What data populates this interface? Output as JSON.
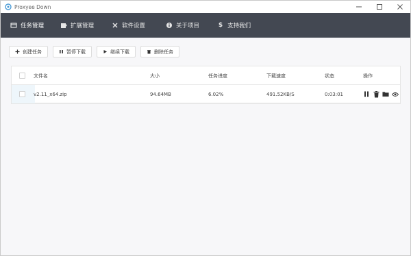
{
  "window": {
    "title": "Proxyee Down",
    "controls": [
      "minimize-icon",
      "maximize-icon",
      "close-icon"
    ]
  },
  "nav": {
    "items": [
      {
        "label": "任务管理",
        "icon": "download-list-icon",
        "active": true
      },
      {
        "label": "扩展管理",
        "icon": "puzzle-icon",
        "active": false
      },
      {
        "label": "软件设置",
        "icon": "tools-icon",
        "active": false
      },
      {
        "label": "关于项目",
        "icon": "info-icon",
        "active": false
      },
      {
        "label": "支持我们",
        "icon": "dollar-icon",
        "active": false
      }
    ]
  },
  "toolbar": {
    "create_label": "创建任务",
    "pause_label": "暂停下载",
    "resume_label": "继续下载",
    "delete_label": "删除任务"
  },
  "table": {
    "headers": {
      "filename": "文件名",
      "size": "大小",
      "progress": "任务进度",
      "speed": "下载速度",
      "status": "状态",
      "actions": "操作"
    },
    "rows": [
      {
        "filename": "v2.11_x64.zip",
        "size": "94.64MB",
        "progress": "6.02%",
        "speed": "491.52KB/S",
        "status": "0:03:01",
        "actions": [
          "pause-icon",
          "trash-icon",
          "folder-icon",
          "eye-icon"
        ]
      }
    ]
  },
  "colors": {
    "navbar": "#434852",
    "background": "#f7f7f9",
    "text": "#444444"
  }
}
